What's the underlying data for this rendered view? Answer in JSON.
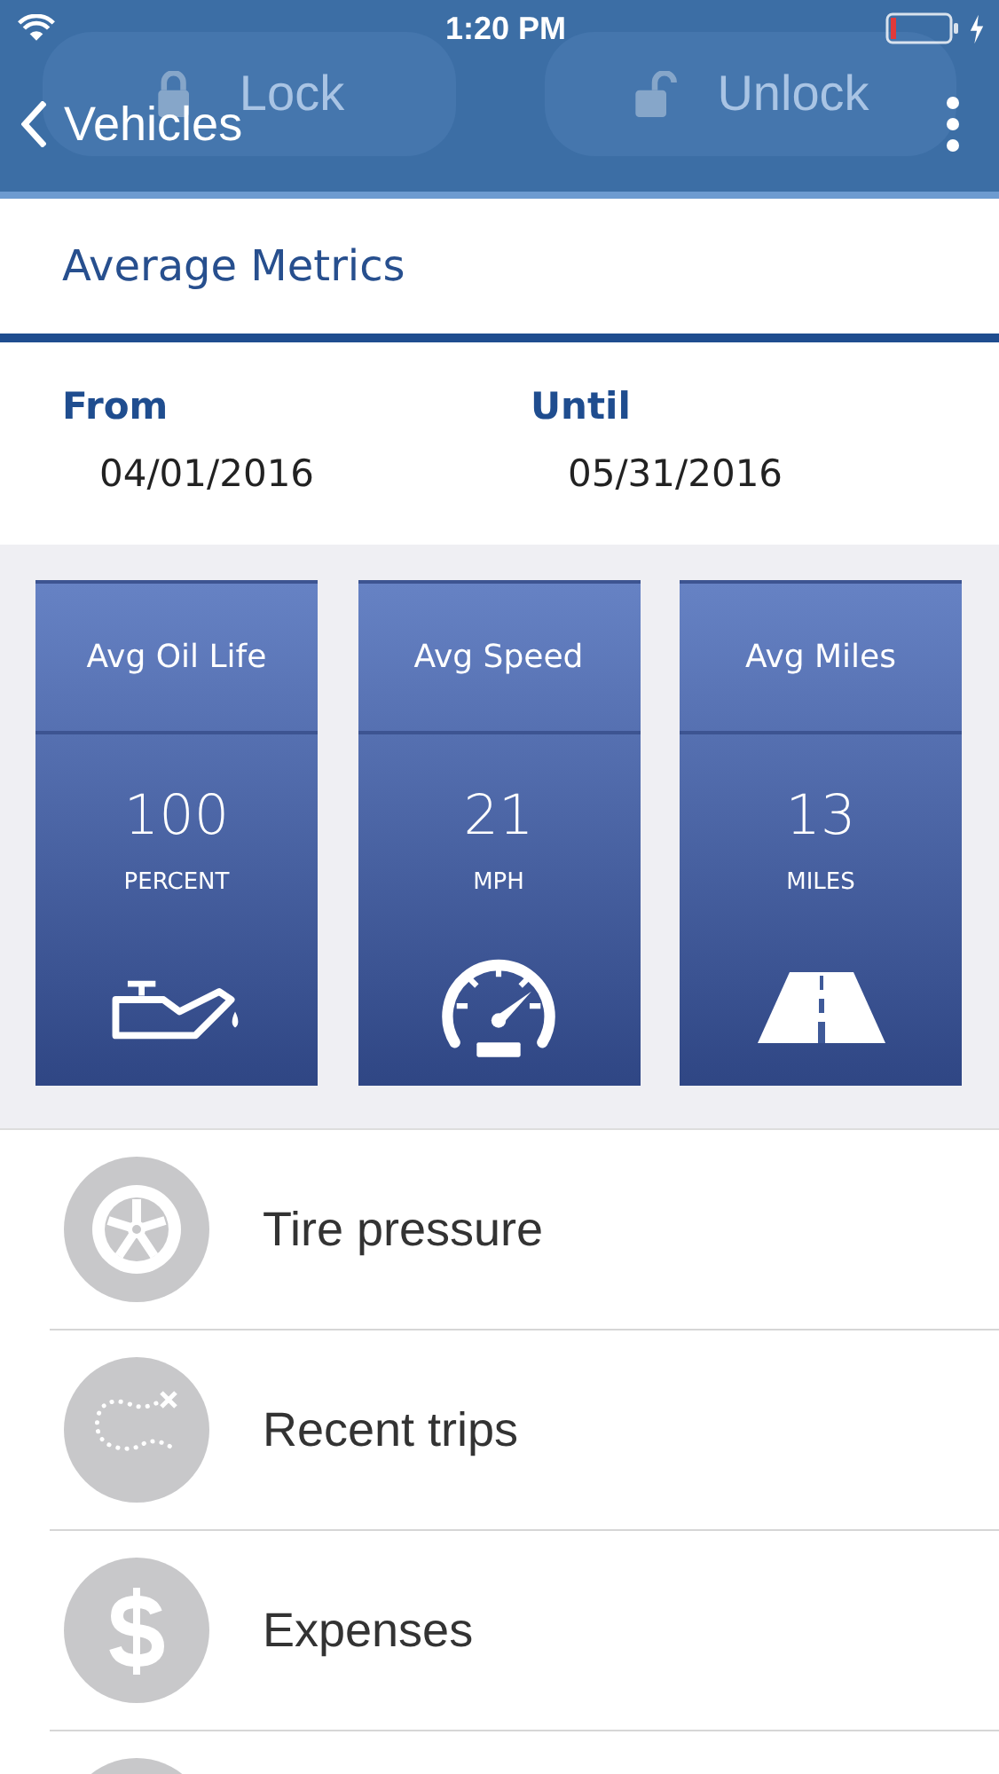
{
  "status_bar": {
    "time": "1:20 PM",
    "charging": true
  },
  "background_buttons": [
    {
      "label": "Lock",
      "kind": "lock"
    },
    {
      "label": "Unlock",
      "kind": "unlock"
    }
  ],
  "nav_bar": {
    "back_label": "Vehicles"
  },
  "section_title": "Average Metrics",
  "date_range": [
    {
      "label": "From",
      "value": "04/01/2016"
    },
    {
      "label": "Until",
      "value": "05/31/2016"
    }
  ],
  "metrics": [
    {
      "title": "Avg Oil Life",
      "value": "100",
      "unit": "PERCENT",
      "kind": "oil"
    },
    {
      "title": "Avg Speed",
      "value": "21",
      "unit": "MPH",
      "kind": "speed"
    },
    {
      "title": "Avg Miles",
      "value": "13",
      "unit": "MILES",
      "kind": "road"
    }
  ],
  "menu_items": [
    {
      "label": "Tire pressure",
      "kind": "tire"
    },
    {
      "label": "Recent trips",
      "kind": "trip"
    },
    {
      "label": "Expenses",
      "kind": "dollar"
    },
    {
      "kind": "blank"
    }
  ]
}
